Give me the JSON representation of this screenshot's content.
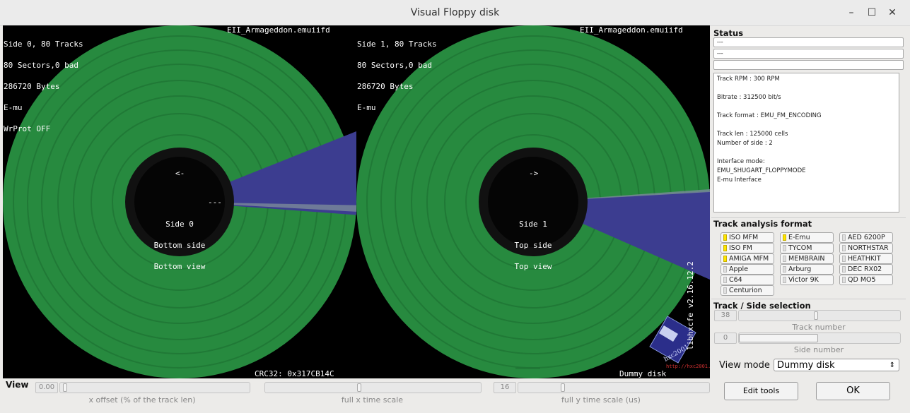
{
  "window": {
    "title": "Visual Floppy disk",
    "minimize": "–",
    "maximize": "☐",
    "close": "✕"
  },
  "side0": {
    "info": [
      "Side 0, 80 Tracks",
      "80 Sectors,0 bad",
      "286720 Bytes",
      "E-mu",
      "WrProt OFF"
    ],
    "filename": "EII_Armageddon.emuiifd",
    "arrow": "<-",
    "dashes": "---",
    "label": [
      "Side 0",
      "Bottom side",
      "Bottom view"
    ]
  },
  "side1": {
    "info": [
      "Side 1, 80 Tracks",
      "80 Sectors,0 bad",
      "286720 Bytes",
      "E-mu"
    ],
    "filename": "EII_Armageddon.emuiifd",
    "arrow": "->",
    "label": [
      "Side 1",
      "Top side",
      "Top view"
    ]
  },
  "footer": {
    "crc": "CRC32: 0x317CB14C",
    "disk_type": "Dummy disk",
    "version": "libhxcfe v2.16.12.2",
    "url": "http://hxc2001.com",
    "logo_text": "hxc2001"
  },
  "status": {
    "title": "Status",
    "fields": [
      "---",
      "---",
      ""
    ],
    "info": [
      "Track RPM : 300 RPM",
      "",
      "Bitrate : 312500 bit/s",
      "",
      "Track format : EMU_FM_ENCODING",
      "",
      "Track len : 125000 cells",
      "Number of side : 2",
      "",
      "Interface mode:",
      "EMU_SHUGART_FLOPPYMODE",
      "E-mu Interface"
    ]
  },
  "track_analysis": {
    "title": "Track analysis format",
    "formats": [
      {
        "label": "ISO MFM",
        "on": true
      },
      {
        "label": "E-Emu",
        "on": true
      },
      {
        "label": "AED 6200P",
        "on": false
      },
      {
        "label": "ISO FM",
        "on": true
      },
      {
        "label": "TYCOM",
        "on": false
      },
      {
        "label": "NORTHSTAR",
        "on": false
      },
      {
        "label": "AMIGA MFM",
        "on": true
      },
      {
        "label": "MEMBRAIN",
        "on": false
      },
      {
        "label": "HEATHKIT",
        "on": false
      },
      {
        "label": "Apple",
        "on": false
      },
      {
        "label": "Arburg",
        "on": false
      },
      {
        "label": "DEC RX02",
        "on": false
      },
      {
        "label": "C64",
        "on": false
      },
      {
        "label": "Victor 9K",
        "on": false
      },
      {
        "label": "QD MO5",
        "on": false
      },
      {
        "label": "Centurion",
        "on": false
      }
    ]
  },
  "track_side": {
    "title": "Track / Side selection",
    "track_value": "38",
    "track_label": "Track number",
    "side_value": "0",
    "side_label": "Side number",
    "view_mode_label": "View mode",
    "view_mode_value": "Dummy disk"
  },
  "view": {
    "title": "View",
    "x_offset_value": "0.00",
    "x_offset_label": "x offset (% of the track len)",
    "x_scale_label": "full x time scale",
    "y_scale_value": "16",
    "y_scale_label": "full y time scale (us)"
  },
  "buttons": {
    "edit_tools": "Edit tools",
    "ok": "OK"
  },
  "colors": {
    "disk_green": "#278a3f",
    "sector_blue": "#3c3d90",
    "background": "#000000"
  }
}
